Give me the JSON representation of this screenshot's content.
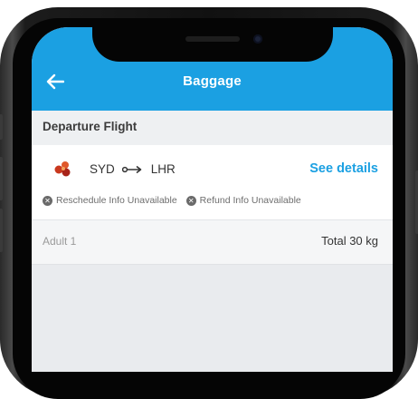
{
  "appbar": {
    "title": "Baggage",
    "back_icon": "arrow-left-icon",
    "color": "#1ba0e2"
  },
  "section": {
    "title": "Departure Flight"
  },
  "flight": {
    "airline_logo": "airline-logo-icon",
    "origin": "SYD",
    "destination": "LHR",
    "route_icon": "route-arrow-icon",
    "details_link": "See details",
    "reschedule_info": "Reschedule Info Unavailable",
    "refund_info": "Refund Info Unavailable",
    "info_icon": "unavailable-icon"
  },
  "passenger": {
    "label": "Adult 1",
    "total": "Total 30 kg"
  }
}
